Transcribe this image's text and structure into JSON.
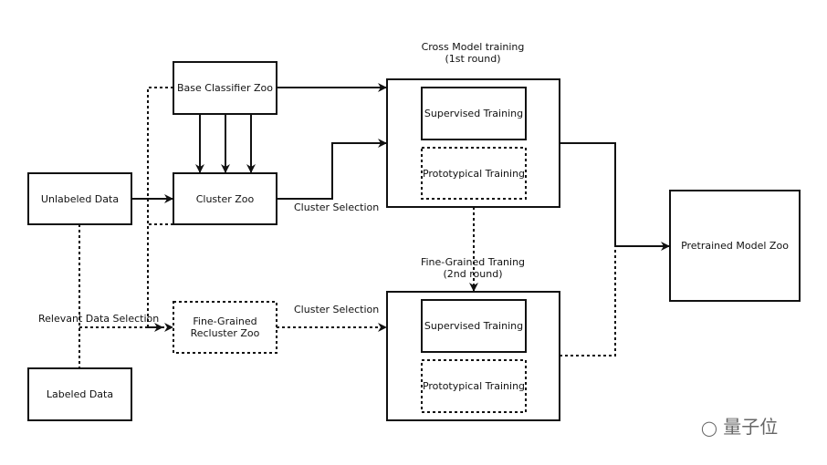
{
  "nodes": {
    "base_classifier_zoo": "Base Classifier Zoo",
    "unlabeled_data": "Unlabeled Data",
    "cluster_zoo": "Cluster Zoo",
    "fine_grained_recluster_zoo": "Fine-Grained\nRecluster Zoo",
    "labeled_data": "Labeled Data",
    "round1_supervised": "Supervised Training",
    "round1_prototypical": "Prototypical Training",
    "round2_supervised": "Supervised Training",
    "round2_prototypical": "Prototypical Training",
    "pretrained_model_zoo": "Pretrained Model Zoo"
  },
  "groups": {
    "round1_title": "Cross Model training\n(1st round)",
    "round2_title": "Fine-Grained Traning\n(2nd round)"
  },
  "edge_labels": {
    "cluster_selection_1": "Cluster Selection",
    "cluster_selection_2": "Cluster Selection",
    "relevant_data_selection": "Relevant Data Selection"
  },
  "watermark": "量子位",
  "colors": {
    "stroke": "#111111",
    "background": "#ffffff"
  }
}
